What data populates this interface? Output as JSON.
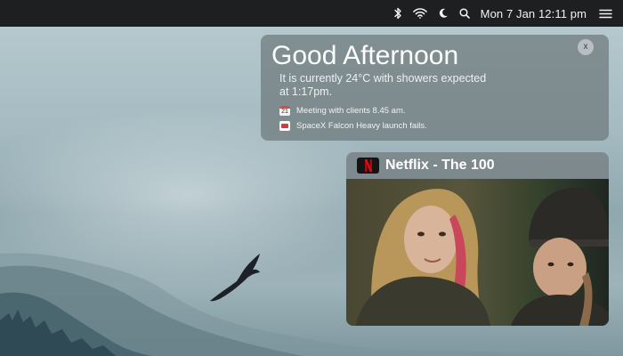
{
  "menubar": {
    "clock": "Mon 7 Jan 12:11 pm",
    "icons": [
      "bluetooth-icon",
      "wifi-icon",
      "moon-icon",
      "search-icon",
      "menu-icon"
    ]
  },
  "greeting": {
    "title": "Good Afternoon",
    "weather": "It is currently 24°C with showers expected at 1:17pm.",
    "close_label": "x",
    "calendar_day": "21",
    "events": [
      {
        "text": "Meeting with clients 8.45 am.",
        "icon": "calendar-icon"
      },
      {
        "text": "SpaceX Falcon Heavy launch fails.",
        "icon": "news-icon"
      }
    ]
  },
  "netflix": {
    "title": "Netflix - The 100",
    "logo_letter": "N",
    "brand_color": "#e50914"
  }
}
